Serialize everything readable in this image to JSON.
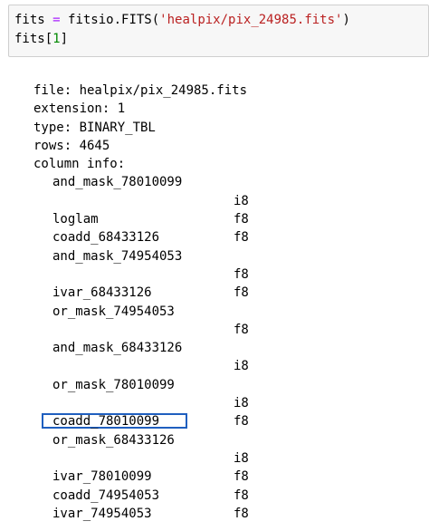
{
  "code_cell": {
    "line1": {
      "var": "fits",
      "eq": " = ",
      "call": "fitsio.FITS(",
      "arg": "'healpix/pix_24985.fits'",
      "close": ")"
    },
    "line2": {
      "var": "fits[",
      "index": "1",
      "close": "]"
    }
  },
  "output": {
    "file_line": "file: healpix/pix_24985.fits",
    "extension_line": "extension: 1",
    "type_line": "type: BINARY_TBL",
    "rows_line": "rows: 4645",
    "column_info_line": "column info:",
    "columns": [
      {
        "name": "and_mask_78010099",
        "type": ""
      },
      {
        "name": "",
        "type": "i8"
      },
      {
        "name": "loglam",
        "type": "f8"
      },
      {
        "name": "coadd_68433126",
        "type": "f8"
      },
      {
        "name": "and_mask_74954053",
        "type": ""
      },
      {
        "name": "",
        "type": "f8"
      },
      {
        "name": "ivar_68433126",
        "type": "f8"
      },
      {
        "name": "or_mask_74954053",
        "type": ""
      },
      {
        "name": "",
        "type": "f8"
      },
      {
        "name": "and_mask_68433126",
        "type": ""
      },
      {
        "name": "",
        "type": "i8"
      },
      {
        "name": "or_mask_78010099",
        "type": ""
      },
      {
        "name": "",
        "type": "i8"
      },
      {
        "name": "coadd_78010099",
        "type": "f8",
        "highlighted": true
      },
      {
        "name": "or_mask_68433126",
        "type": ""
      },
      {
        "name": "",
        "type": "i8"
      },
      {
        "name": "ivar_78010099",
        "type": "f8"
      },
      {
        "name": "coadd_74954053",
        "type": "f8"
      },
      {
        "name": "ivar_74954053",
        "type": "f8"
      }
    ]
  },
  "colors": {
    "cell_background": "#f7f7f7",
    "cell_border": "#cfcfcf",
    "operator": "#aa22ff",
    "string": "#ba2121",
    "number": "#008800",
    "highlight_border": "#1f5fbf"
  }
}
